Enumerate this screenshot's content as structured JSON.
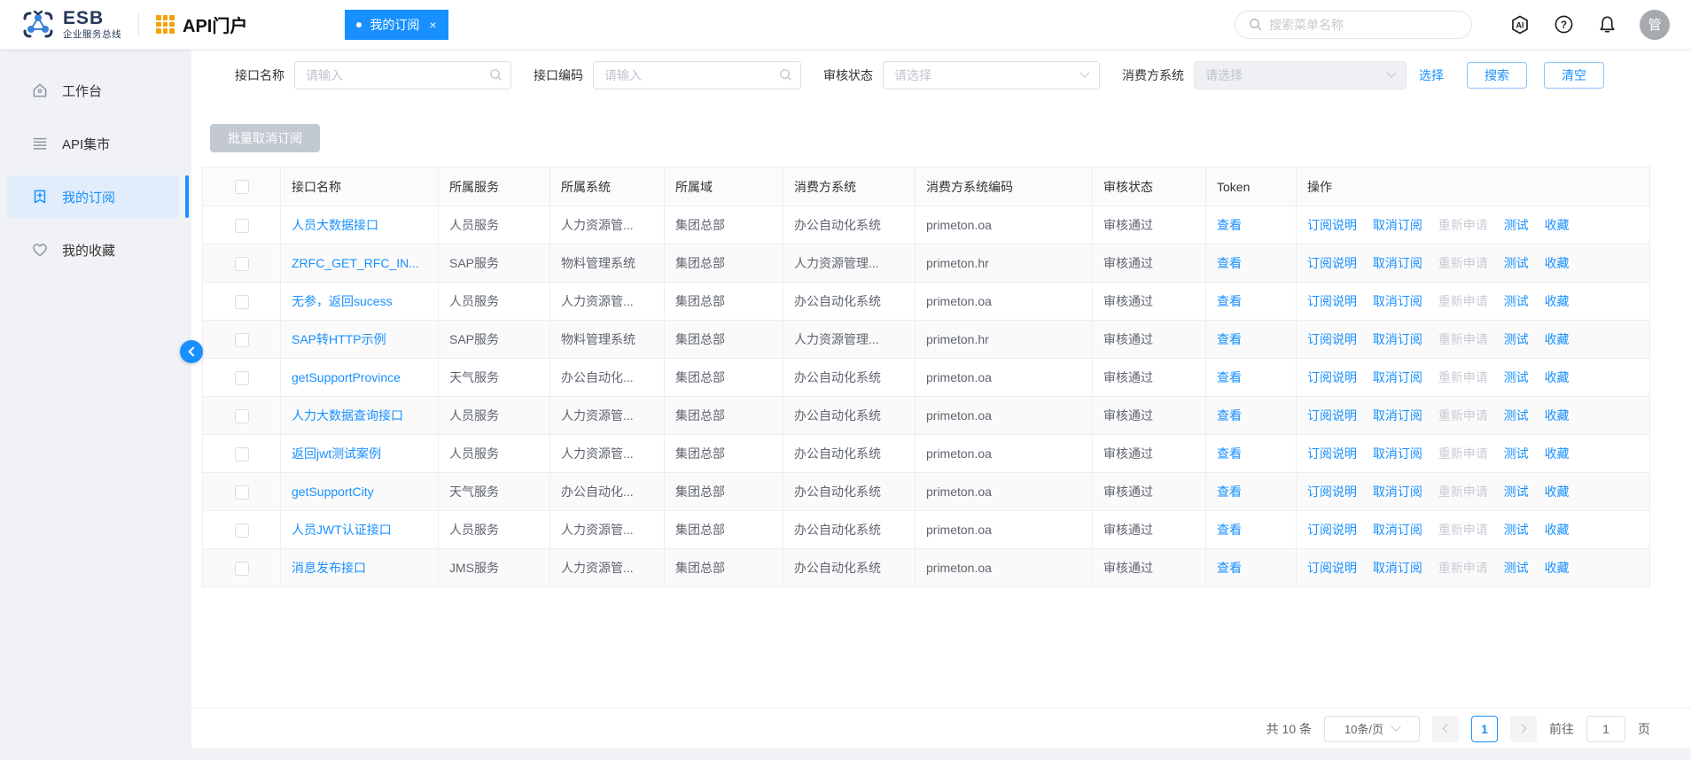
{
  "colors": {
    "accent": "#1890ff",
    "orange": "#f0a30a",
    "brand-navy": "#253858",
    "sidebar-active-bg": "#e2edfb",
    "disabled-btn": "#c3c9d2",
    "avatar-gray": "#a6a9ad"
  },
  "header": {
    "brand": "ESB",
    "brand_subtitle": "企业服务总线",
    "portal_title": "API门户",
    "tab": {
      "label": "我的订阅",
      "close": "×"
    },
    "search_placeholder": "搜索菜单名称",
    "ai_icon_label": "AI",
    "help_icon_label": "?",
    "avatar_text": "管"
  },
  "sidebar": {
    "items": [
      {
        "label": "工作台",
        "icon": "home-icon",
        "active": false
      },
      {
        "label": "API集市",
        "icon": "list-icon",
        "active": false
      },
      {
        "label": "我的订阅",
        "icon": "bookmark-plus-icon",
        "active": true
      },
      {
        "label": "我的收藏",
        "icon": "heart-icon",
        "active": false
      }
    ]
  },
  "filters": {
    "name_label": "接口名称",
    "name_placeholder": "请输入",
    "code_label": "接口编码",
    "code_placeholder": "请输入",
    "status_label": "审核状态",
    "status_placeholder": "请选择",
    "consumer_label": "消费方系统",
    "consumer_placeholder": "请选择",
    "select_link": "选择",
    "search_button": "搜索",
    "clear_button": "清空"
  },
  "toolbar": {
    "batch_unsubscribe": "批量取消订阅"
  },
  "table": {
    "columns": [
      "接口名称",
      "所属服务",
      "所属系统",
      "所属域",
      "消费方系统",
      "消费方系统编码",
      "审核状态",
      "Token",
      "操作"
    ],
    "token_link": "查看",
    "actions": {
      "subscribe_info": "订阅说明",
      "unsubscribe": "取消订阅",
      "reapply": "重新申请",
      "test": "测试",
      "favorite": "收藏"
    },
    "rows": [
      {
        "name": "人员大数据接口",
        "service": "人员服务",
        "system": "人力资源管...",
        "domain": "集团总部",
        "consumer": "办公自动化系统",
        "consumer_code": "primeton.oa",
        "status": "审核通过"
      },
      {
        "name": "ZRFC_GET_RFC_IN...",
        "service": "SAP服务",
        "system": "物料管理系统",
        "domain": "集团总部",
        "consumer": "人力资源管理...",
        "consumer_code": "primeton.hr",
        "status": "审核通过"
      },
      {
        "name": "无参，返回sucess",
        "service": "人员服务",
        "system": "人力资源管...",
        "domain": "集团总部",
        "consumer": "办公自动化系统",
        "consumer_code": "primeton.oa",
        "status": "审核通过"
      },
      {
        "name": "SAP转HTTP示例",
        "service": "SAP服务",
        "system": "物料管理系统",
        "domain": "集团总部",
        "consumer": "人力资源管理...",
        "consumer_code": "primeton.hr",
        "status": "审核通过"
      },
      {
        "name": "getSupportProvince",
        "service": "天气服务",
        "system": "办公自动化...",
        "domain": "集团总部",
        "consumer": "办公自动化系统",
        "consumer_code": "primeton.oa",
        "status": "审核通过"
      },
      {
        "name": "人力大数据查询接口",
        "service": "人员服务",
        "system": "人力资源管...",
        "domain": "集团总部",
        "consumer": "办公自动化系统",
        "consumer_code": "primeton.oa",
        "status": "审核通过"
      },
      {
        "name": "返回jwt测试案例",
        "service": "人员服务",
        "system": "人力资源管...",
        "domain": "集团总部",
        "consumer": "办公自动化系统",
        "consumer_code": "primeton.oa",
        "status": "审核通过"
      },
      {
        "name": "getSupportCity",
        "service": "天气服务",
        "system": "办公自动化...",
        "domain": "集团总部",
        "consumer": "办公自动化系统",
        "consumer_code": "primeton.oa",
        "status": "审核通过"
      },
      {
        "name": "人员JWT认证接口",
        "service": "人员服务",
        "system": "人力资源管...",
        "domain": "集团总部",
        "consumer": "办公自动化系统",
        "consumer_code": "primeton.oa",
        "status": "审核通过"
      },
      {
        "name": "消息发布接口",
        "service": "JMS服务",
        "system": "人力资源管...",
        "domain": "集团总部",
        "consumer": "办公自动化系统",
        "consumer_code": "primeton.oa",
        "status": "审核通过"
      }
    ]
  },
  "pagination": {
    "total": "共 10 条",
    "page_size": "10条/页",
    "current_page": "1",
    "goto_label": "前往",
    "goto_value": "1",
    "page_unit": "页"
  }
}
